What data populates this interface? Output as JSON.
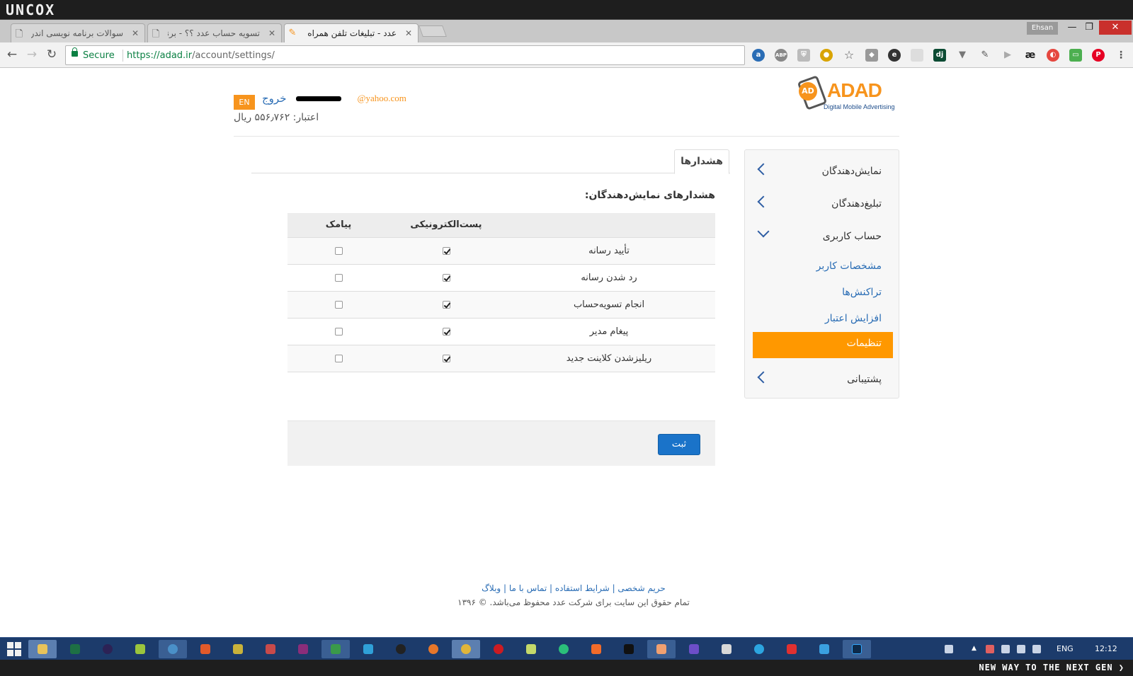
{
  "os": {
    "brand": "UNCOX",
    "slogan": "NEW WAY TO THE NEXT GEN ❯",
    "user": "Ehsan",
    "clock": "12:12",
    "lang": "ENG"
  },
  "browser": {
    "tabs": [
      {
        "label": "سوالات برنامه نویسی اندرو",
        "close": "✕",
        "icon": "doc-icon"
      },
      {
        "label": "تسویه حساب عدد ؟؟ - برنا",
        "close": "✕",
        "icon": "doc-icon"
      },
      {
        "label": "عدد - تبلیغات تلفن همراه",
        "close": "✕",
        "icon": "adad-favicon"
      }
    ],
    "secure_label": "Secure",
    "url_host": "https://adad.ir",
    "url_path": "/account/settings/",
    "window_controls": {
      "minimize": "—",
      "maximize": "❐",
      "close": "✕"
    }
  },
  "header": {
    "brand_name": "ADAD",
    "brand_badge": "AD",
    "brand_tagline": "Digital Mobile Advertising",
    "lang_button": "EN",
    "logout": "خروج",
    "email": "@yahoo.com",
    "credit": "اعتبار: ۵۵۶٫۷۶۲ ریال"
  },
  "sidebar": {
    "items": [
      {
        "label": "نمایش‌دهندگان",
        "expanded": false
      },
      {
        "label": "تبلیغ‌دهندگان",
        "expanded": false
      },
      {
        "label": "حساب کاربری",
        "expanded": true
      },
      {
        "label": "پشتیبانی",
        "expanded": false
      }
    ],
    "subitems": [
      {
        "label": "مشخصات کاربر",
        "active": false
      },
      {
        "label": "تراکنش‌ها",
        "active": false
      },
      {
        "label": "افزایش اعتبار",
        "active": false
      },
      {
        "label": "تنظیمات",
        "active": true
      }
    ]
  },
  "main": {
    "tab": "هشدارها",
    "section_title": "هشدارهای نمایش‌دهندگان:",
    "table": {
      "headers": [
        "",
        "پست‌الکترونیکی",
        "پیامک"
      ],
      "rows": [
        {
          "name": "تأیید رسانه",
          "email": true,
          "sms": false
        },
        {
          "name": "رد شدن رسانه",
          "email": true,
          "sms": false
        },
        {
          "name": "انجام تسویه‌حساب",
          "email": true,
          "sms": false
        },
        {
          "name": "پیغام مدیر",
          "email": true,
          "sms": false
        },
        {
          "name": "ریلیزشدن کلاینت جدید",
          "email": true,
          "sms": false
        }
      ]
    },
    "submit": "ثبت"
  },
  "footer": {
    "links": "حریم شخصی | شرایط استفاده | تماس با ما | وبلاگ",
    "copyright": "تمام حقوق این سایت برای شرکت عدد محفوظ می‌باشد. © ۱۳۹۶"
  },
  "colors": {
    "accent": "#ff9800",
    "link": "#2a6db5",
    "button": "#1a73c9",
    "taskbar": "#1c3b6b"
  }
}
